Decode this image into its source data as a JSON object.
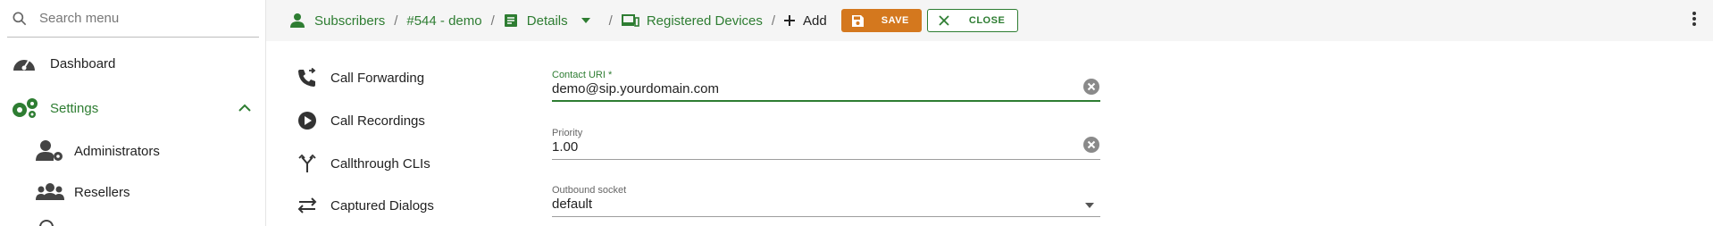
{
  "sidebar": {
    "search_placeholder": "Search menu",
    "items": [
      {
        "label": "Dashboard",
        "icon": "speedometer-icon"
      },
      {
        "label": "Settings",
        "icon": "cogs-icon",
        "active": true
      },
      {
        "label": "Administrators",
        "icon": "admin-user-icon"
      },
      {
        "label": "Resellers",
        "icon": "group-icon"
      }
    ]
  },
  "breadcrumb": {
    "subscribers": "Subscribers",
    "subscriber": "#544 - demo",
    "details": "Details",
    "registered_devices": "Registered Devices",
    "add": "Add",
    "separator": "/"
  },
  "toolbar": {
    "save_label": "SAVE",
    "close_label": "CLOSE"
  },
  "submenu": [
    {
      "label": "Call Forwarding",
      "icon": "call-forward-icon"
    },
    {
      "label": "Call Recordings",
      "icon": "play-circle-icon"
    },
    {
      "label": "Callthrough CLIs",
      "icon": "merge-icon"
    },
    {
      "label": "Captured Dialogs",
      "icon": "swap-arrows-icon"
    }
  ],
  "form": {
    "contact_uri": {
      "label": "Contact URI",
      "required_mark": "*",
      "value": "demo@sip.yourdomain.com"
    },
    "priority": {
      "label": "Priority",
      "value": "1.00"
    },
    "outbound_socket": {
      "label": "Outbound socket",
      "value": "default"
    }
  },
  "colors": {
    "accent": "#2e7d32",
    "save_button": "#d4781e",
    "topbar_bg": "#f5f5f5"
  }
}
